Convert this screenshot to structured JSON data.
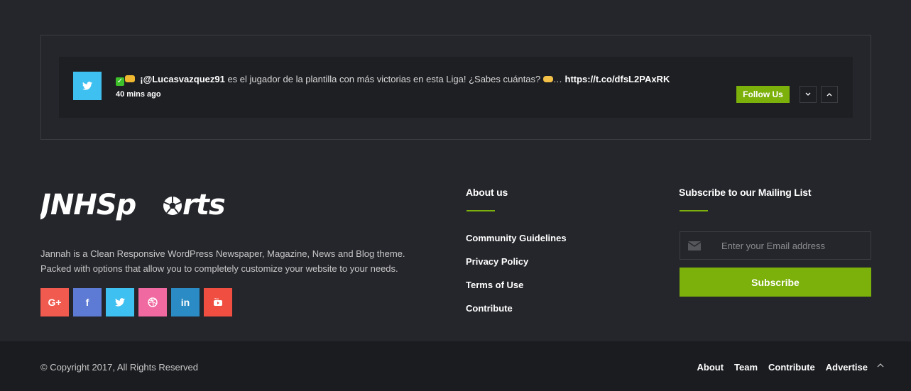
{
  "tweet": {
    "handle": "¡@Lucasvazquez91",
    "text": " es el jugador de la plantilla con más victorias en esta Liga! ¿Sabes cuántas? ",
    "ellipsis": "…",
    "link": "https://t.co/dfsL2PAxRK",
    "time": "40 mins ago",
    "follow_label": "Follow Us"
  },
  "brand": {
    "logo_text_left": "JNHSp",
    "logo_text_right": "rts",
    "about": "Jannah is a Clean Responsive WordPress Newspaper, Magazine, News and Blog theme. Packed with options that allow you to completely customize your website to your needs."
  },
  "social": [
    {
      "name": "google-plus",
      "label": "G+",
      "color": "#f05a4f"
    },
    {
      "name": "facebook",
      "label": "f",
      "color": "#5d7bd5"
    },
    {
      "name": "twitter",
      "label": "",
      "color": "#3ec0f0"
    },
    {
      "name": "dribbble",
      "label": "",
      "color": "#f069a1"
    },
    {
      "name": "linkedin",
      "label": "in",
      "color": "#2a8bc5"
    },
    {
      "name": "youtube",
      "label": "",
      "color": "#ef4e41"
    }
  ],
  "about_widget": {
    "title": "About us",
    "links": [
      "Community Guidelines",
      "Privacy Policy",
      "Terms of Use",
      "Contribute"
    ]
  },
  "subscribe_widget": {
    "title": "Subscribe to our Mailing List",
    "placeholder": "Enter your Email address",
    "button": "Subscribe"
  },
  "bottom": {
    "copyright": "© Copyright 2017, All Rights Reserved",
    "links": [
      "About",
      "Team",
      "Contribute",
      "Advertise"
    ]
  },
  "colors": {
    "accent": "#7cb00b",
    "background": "#25262b",
    "bottom_bar": "#1b1c20"
  }
}
